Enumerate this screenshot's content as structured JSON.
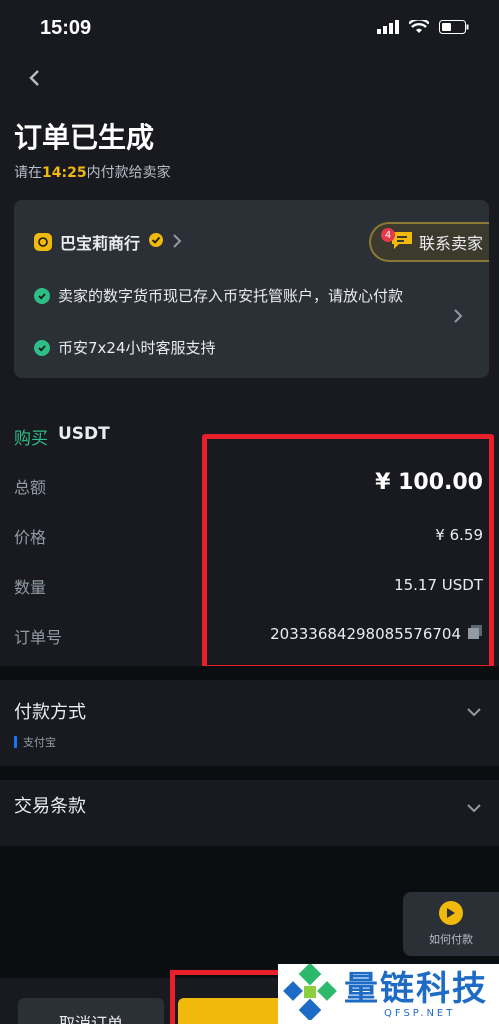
{
  "status_bar": {
    "time": "15:09"
  },
  "header": {
    "title": "订单已生成",
    "subtitle_prefix": "请在",
    "countdown": "14:25",
    "subtitle_suffix": "内付款给卖家"
  },
  "seller": {
    "name": "巴宝莉商行",
    "contact_label": "联系卖家",
    "unread_count": "4",
    "notices": [
      "卖家的数字货币现已存入币安托管账户，请放心付款",
      "币安7x24小时客服支持"
    ]
  },
  "order": {
    "trade_type": "购买",
    "asset": "USDT",
    "rows": [
      {
        "label": "总额",
        "value": "¥ 100.00"
      },
      {
        "label": "价格",
        "value": "¥ 6.59"
      },
      {
        "label": "数量",
        "value": "15.17 USDT"
      },
      {
        "label": "订单号",
        "value": "20333684298085576704"
      }
    ]
  },
  "payment": {
    "title": "付款方式",
    "method": "支付宝"
  },
  "terms": {
    "title": "交易条款"
  },
  "help": {
    "how_to_pay": "如何付款"
  },
  "actions": {
    "cancel": "取消订单"
  },
  "watermark": {
    "title": "量链科技",
    "url": "QFSP.NET"
  },
  "colors": {
    "accent": "#f0b90b",
    "buy": "#2ebd85",
    "highlight": "#e8202a",
    "background": "#181a20"
  }
}
